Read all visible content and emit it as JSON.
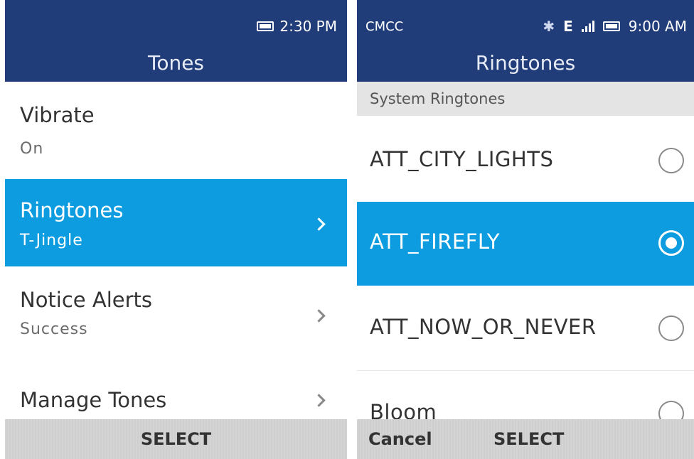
{
  "left_screen": {
    "status": {
      "time": "2:30 PM",
      "icons": [
        "battery-icon"
      ]
    },
    "title": "Tones",
    "items": [
      {
        "title": "Vibrate",
        "subtitle": "On"
      },
      {
        "title": "Ringtones",
        "subtitle": "T-Jingle",
        "selected": true
      },
      {
        "title": "Notice Alerts",
        "subtitle": "Success"
      },
      {
        "title": "Manage Tones"
      }
    ],
    "softkeys": {
      "center": "SELECT"
    }
  },
  "right_screen": {
    "status": {
      "carrier": "CMCC",
      "network": "E",
      "time": "9:00 AM",
      "icons": [
        "bluetooth-icon",
        "signal-icon",
        "battery-icon"
      ]
    },
    "title": "Ringtones",
    "section": "System Ringtones",
    "ringtones": [
      {
        "name": "ATT_CITY_LIGHTS",
        "selected": false
      },
      {
        "name": "ATT_FIREFLY",
        "selected": true
      },
      {
        "name": "ATT_NOW_OR_NEVER",
        "selected": false
      },
      {
        "name": "Bloom",
        "selected": false
      }
    ],
    "softkeys": {
      "left": "Cancel",
      "center": "SELECT"
    }
  },
  "colors": {
    "header": "#213d79",
    "selection": "#0e9ce0",
    "softkey_bar": "#d2d2d2"
  }
}
